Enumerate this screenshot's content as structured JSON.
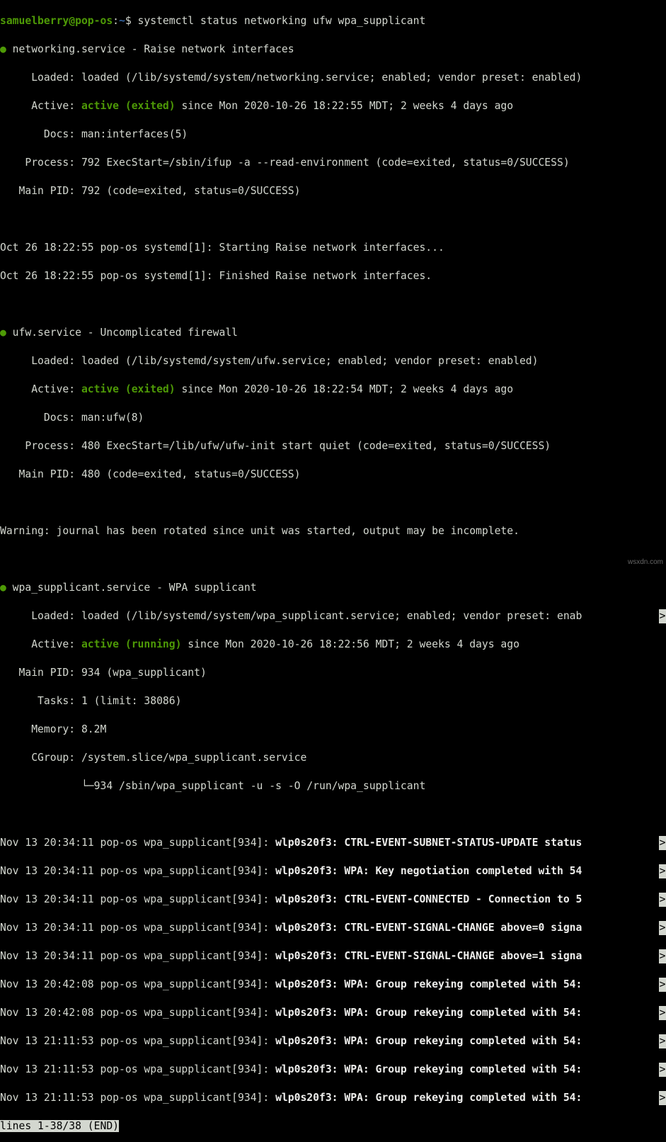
{
  "prompt": {
    "user": "samuelberry@pop-os",
    "sep1": ":",
    "dir": "~",
    "sep2": "$ ",
    "command": "systemctl status networking ufw wpa_supplicant"
  },
  "blank": " ",
  "chev": ">",
  "services": [
    {
      "bullet": "●",
      "title": " networking.service - Raise network interfaces",
      "loaded": "     Loaded: loaded (/lib/systemd/system/networking.service; enabled; vendor preset: enabled)",
      "active_prefix": "     Active: ",
      "active_state": "active (exited)",
      "active_suffix": " since Mon 2020-10-26 18:22:55 MDT; 2 weeks 4 days ago",
      "docs": "       Docs: man:interfaces(5)",
      "process": "    Process: 792 ExecStart=/sbin/ifup -a --read-environment (code=exited, status=0/SUCCESS)",
      "mainpid": "   Main PID: 792 (code=exited, status=0/SUCCESS)",
      "log": [
        "Oct 26 18:22:55 pop-os systemd[1]: Starting Raise network interfaces...",
        "Oct 26 18:22:55 pop-os systemd[1]: Finished Raise network interfaces."
      ]
    },
    {
      "bullet": "●",
      "title": " ufw.service - Uncomplicated firewall",
      "loaded": "     Loaded: loaded (/lib/systemd/system/ufw.service; enabled; vendor preset: enabled)",
      "active_prefix": "     Active: ",
      "active_state": "active (exited)",
      "active_suffix": " since Mon 2020-10-26 18:22:54 MDT; 2 weeks 4 days ago",
      "docs": "       Docs: man:ufw(8)",
      "process": "    Process: 480 ExecStart=/lib/ufw/ufw-init start quiet (code=exited, status=0/SUCCESS)",
      "mainpid": "   Main PID: 480 (code=exited, status=0/SUCCESS)",
      "warning": "Warning: journal has been rotated since unit was started, output may be incomplete."
    },
    {
      "bullet": "●",
      "title": " wpa_supplicant.service - WPA supplicant",
      "loaded": "     Loaded: loaded (/lib/systemd/system/wpa_supplicant.service; enabled; vendor preset: enab",
      "active_prefix": "     Active: ",
      "active_state": "active (running)",
      "active_suffix": " since Mon 2020-10-26 18:22:56 MDT; 2 weeks 4 days ago",
      "mainpid": "   Main PID: 934 (wpa_supplicant)",
      "tasks": "      Tasks: 1 (limit: 38086)",
      "memory": "     Memory: 8.2M",
      "cgroup": "     CGroup: /system.slice/wpa_supplicant.service",
      "cgproc": "             └─934 /sbin/wpa_supplicant -u -s -O /run/wpa_supplicant",
      "log": [
        {
          "pre": "Nov 13 20:34:11 pop-os wpa_supplicant[934]: ",
          "bold": "wlp0s20f3: CTRL-EVENT-SUBNET-STATUS-UPDATE status"
        },
        {
          "pre": "Nov 13 20:34:11 pop-os wpa_supplicant[934]: ",
          "bold": "wlp0s20f3: WPA: Key negotiation completed with 54"
        },
        {
          "pre": "Nov 13 20:34:11 pop-os wpa_supplicant[934]: ",
          "bold": "wlp0s20f3: CTRL-EVENT-CONNECTED - Connection to 5"
        },
        {
          "pre": "Nov 13 20:34:11 pop-os wpa_supplicant[934]: ",
          "bold": "wlp0s20f3: CTRL-EVENT-SIGNAL-CHANGE above=0 signa"
        },
        {
          "pre": "Nov 13 20:34:11 pop-os wpa_supplicant[934]: ",
          "bold": "wlp0s20f3: CTRL-EVENT-SIGNAL-CHANGE above=1 signa"
        },
        {
          "pre": "Nov 13 20:42:08 pop-os wpa_supplicant[934]: ",
          "bold": "wlp0s20f3: WPA: Group rekeying completed with 54:"
        },
        {
          "pre": "Nov 13 20:42:08 pop-os wpa_supplicant[934]: ",
          "bold": "wlp0s20f3: WPA: Group rekeying completed with 54:"
        },
        {
          "pre": "Nov 13 21:11:53 pop-os wpa_supplicant[934]: ",
          "bold": "wlp0s20f3: WPA: Group rekeying completed with 54:"
        },
        {
          "pre": "Nov 13 21:11:53 pop-os wpa_supplicant[934]: ",
          "bold": "wlp0s20f3: WPA: Group rekeying completed with 54:"
        },
        {
          "pre": "Nov 13 21:11:53 pop-os wpa_supplicant[934]: ",
          "bold": "wlp0s20f3: WPA: Group rekeying completed with 54:"
        }
      ]
    }
  ],
  "pager_status": "lines 1-38/38 (END)",
  "watermark": "wsxdn.com"
}
